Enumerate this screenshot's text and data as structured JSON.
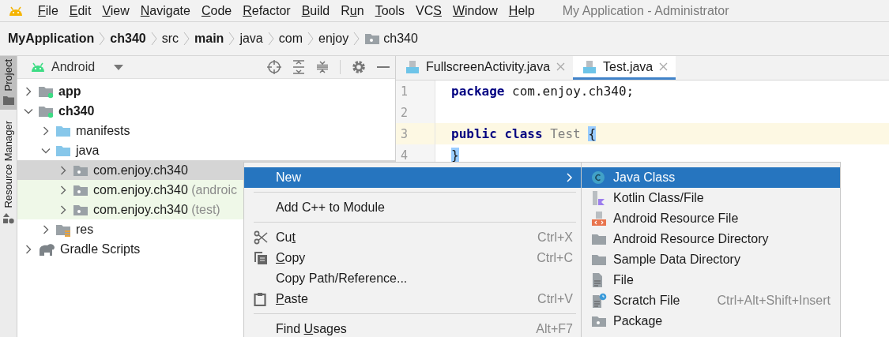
{
  "menu_bar": {
    "items": [
      {
        "mnemonic": "F",
        "after": "ile"
      },
      {
        "mnemonic": "E",
        "after": "dit"
      },
      {
        "mnemonic": "V",
        "after": "iew"
      },
      {
        "mnemonic": "N",
        "after": "avigate"
      },
      {
        "mnemonic": "C",
        "after": "ode"
      },
      {
        "mnemonic": "R",
        "after": "efactor"
      },
      {
        "mnemonic": "B",
        "after": "uild"
      },
      {
        "before": "R",
        "mnemonic": "u",
        "after": "n"
      },
      {
        "mnemonic": "T",
        "after": "ools"
      },
      {
        "before": "VC",
        "mnemonic": "S"
      },
      {
        "mnemonic": "W",
        "after": "indow"
      },
      {
        "mnemonic": "H",
        "after": "elp"
      }
    ],
    "window_title": "My Application - Administrator"
  },
  "breadcrumbs": [
    {
      "label": "MyApplication",
      "bold": true
    },
    {
      "label": "ch340",
      "bold": true
    },
    {
      "label": "src",
      "bold": false
    },
    {
      "label": "main",
      "bold": true
    },
    {
      "label": "java",
      "bold": false
    },
    {
      "label": "com",
      "bold": false
    },
    {
      "label": "enjoy",
      "bold": false
    },
    {
      "label": "ch340",
      "bold": false
    }
  ],
  "side_tabs": [
    {
      "label": "Project",
      "selected": true
    },
    {
      "label": "Resource Manager",
      "selected": false
    }
  ],
  "project_panel": {
    "view": "Android",
    "tree": [
      {
        "kind": "module",
        "label": "app",
        "expanded": false,
        "selected": false
      },
      {
        "kind": "module",
        "label": "ch340",
        "expanded": true,
        "selected": false,
        "children": [
          {
            "kind": "folder",
            "label": "manifests",
            "expanded": false,
            "selected": false
          },
          {
            "kind": "folder",
            "label": "java",
            "expanded": true,
            "selected": false,
            "children": [
              {
                "kind": "package",
                "label": "com.enjoy.ch340",
                "expanded": false,
                "selected": true
              },
              {
                "kind": "test-package",
                "label": "com.enjoy.ch340",
                "suffix": "(androic",
                "expanded": false,
                "selected": false
              },
              {
                "kind": "test-package",
                "label": "com.enjoy.ch340",
                "suffix": "(test)",
                "expanded": false,
                "selected": false
              }
            ]
          },
          {
            "kind": "res-folder",
            "label": "res",
            "expanded": false,
            "selected": false
          }
        ]
      },
      {
        "kind": "gradle",
        "label": "Gradle Scripts",
        "expanded": false,
        "selected": false
      }
    ]
  },
  "editor": {
    "tabs": [
      {
        "label": "FullscreenActivity.java",
        "selected": false
      },
      {
        "label": "Test.java",
        "selected": true
      }
    ],
    "lines": [
      {
        "number": "1",
        "current": false,
        "tokens": [
          {
            "kind": "keyword",
            "text": "package"
          },
          {
            "kind": "plain",
            "text": "com.enjoy.ch340;"
          }
        ]
      },
      {
        "number": "2",
        "current": false
      },
      {
        "number": "3",
        "current": true,
        "tokens": [
          {
            "kind": "keyword",
            "text": "public class"
          },
          {
            "kind": "class-name",
            "text": "Test"
          },
          {
            "kind": "brace-match",
            "text": "{"
          }
        ]
      },
      {
        "number": "4",
        "current": false,
        "tokens": [
          {
            "kind": "brace-match",
            "text": "}"
          }
        ]
      }
    ]
  },
  "context_menu": {
    "items": [
      {
        "kind": "item",
        "label": "New",
        "selected": true,
        "submenu": true
      },
      {
        "kind": "separator"
      },
      {
        "kind": "item",
        "label": "Add C++ to Module",
        "selected": false,
        "submenu": false
      },
      {
        "kind": "separator"
      },
      {
        "kind": "item",
        "before": "Cu",
        "mnemonic": "t",
        "shortcut": "Ctrl+X",
        "selected": false,
        "submenu": false
      },
      {
        "kind": "item",
        "mnemonic": "C",
        "after": "opy",
        "shortcut": "Ctrl+C",
        "selected": false,
        "submenu": false
      },
      {
        "kind": "item",
        "label": "Copy Path/Reference...",
        "selected": false,
        "submenu": false
      },
      {
        "kind": "item",
        "mnemonic": "P",
        "after": "aste",
        "shortcut": "Ctrl+V",
        "selected": false,
        "submenu": false
      },
      {
        "kind": "separator"
      },
      {
        "kind": "item",
        "before": "Find ",
        "mnemonic": "U",
        "after": "sages",
        "shortcut": "Alt+F7",
        "selected": false,
        "submenu": false
      }
    ]
  },
  "submenu": {
    "items": [
      {
        "label": "Java Class",
        "selected": true
      },
      {
        "label": "Kotlin Class/File",
        "selected": false
      },
      {
        "label": "Android Resource File",
        "selected": false
      },
      {
        "label": "Android Resource Directory",
        "selected": false
      },
      {
        "label": "Sample Data Directory",
        "selected": false
      },
      {
        "label": "File",
        "selected": false
      },
      {
        "label": "Scratch File",
        "shortcut": "Ctrl+Alt+Shift+Insert",
        "selected": false
      },
      {
        "label": "Package",
        "selected": false
      }
    ]
  }
}
